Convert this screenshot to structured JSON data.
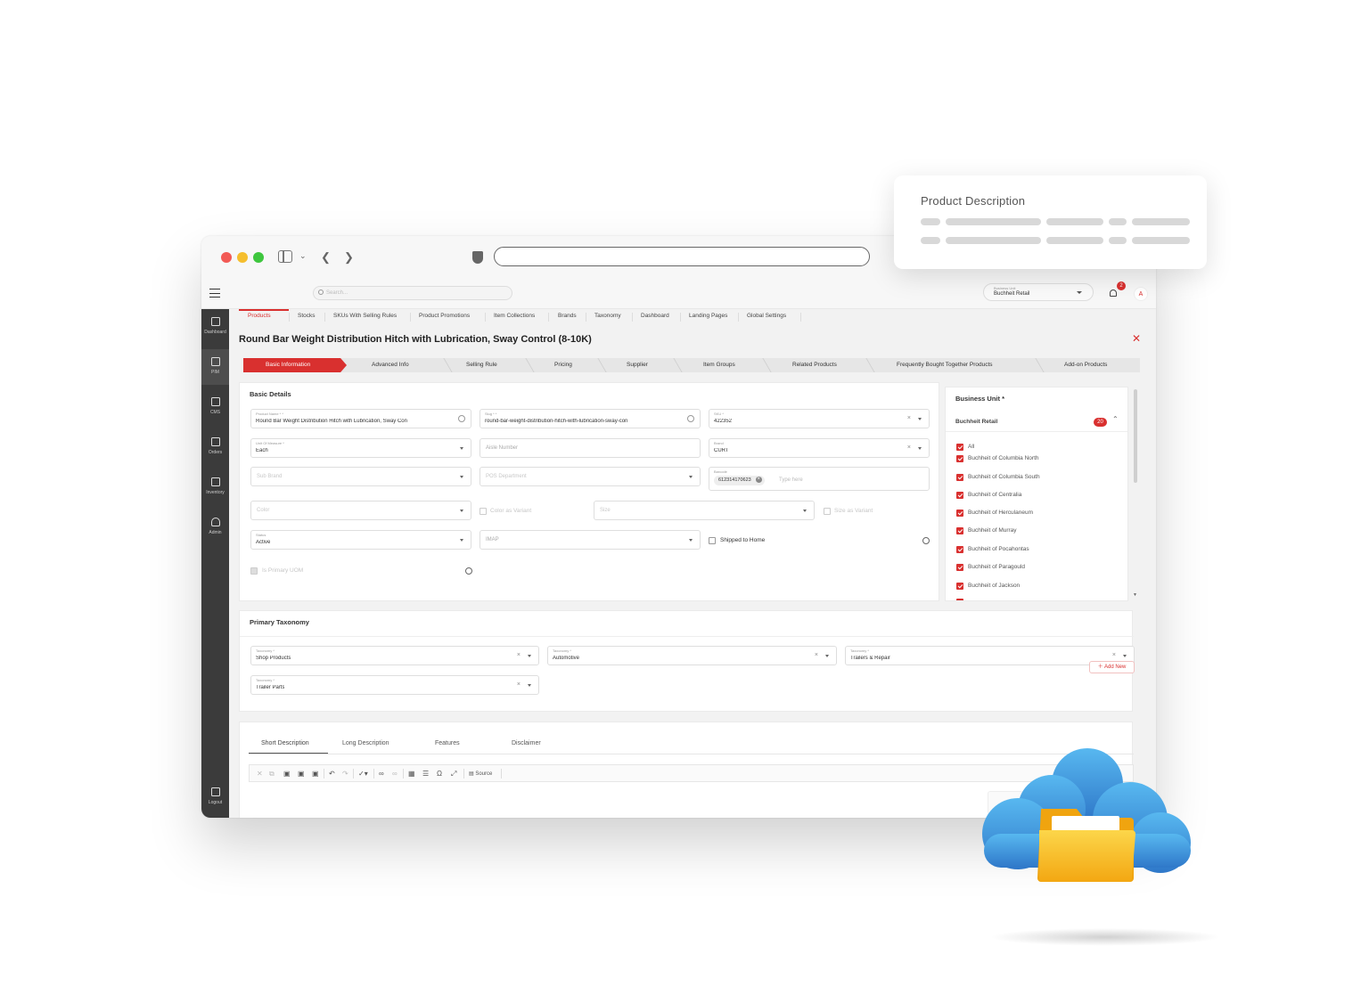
{
  "topbar": {
    "search_placeholder": "Search...",
    "business_unit_label": "Business Unit",
    "business_unit_value": "Buchheit Retail",
    "notification_count": "2",
    "avatar_initial": "A"
  },
  "leftnav": [
    {
      "label": "Dashboard",
      "icon": "dashboard-icon"
    },
    {
      "label": "PIM",
      "icon": "pim-icon"
    },
    {
      "label": "CMS",
      "icon": "cms-icon"
    },
    {
      "label": "Orders",
      "icon": "orders-icon"
    },
    {
      "label": "Inventory",
      "icon": "inventory-icon"
    },
    {
      "label": "Admin",
      "icon": "admin-icon"
    },
    {
      "label": "Logout",
      "icon": "logout-icon"
    }
  ],
  "tabs": [
    "Products",
    "Stocks",
    "SKUs With Selling Rules",
    "Product Promotions",
    "Item Collections",
    "Brands",
    "Taxonomy",
    "Dashboard",
    "Landing Pages",
    "Global Settings"
  ],
  "page_title": "Round Bar Weight Distribution Hitch with Lubrication, Sway Control (8-10K)",
  "steps": [
    "Basic Information",
    "Advanced Info",
    "Selling Rule",
    "Pricing",
    "Supplier",
    "Item Groups",
    "Related Products",
    "Frequently Bought Together Products",
    "Add-on Products"
  ],
  "basic_details": {
    "title": "Basic Details",
    "product_name": {
      "label": "Product Name * *",
      "value": "Round Bar Weight Distribution Hitch with Lubrication, Sway Con"
    },
    "slug": {
      "label": "Slug * *",
      "value": "round-bar-weight-distribution-hitch-with-lubrication-sway-con"
    },
    "sku": {
      "label": "SKU *",
      "value": "422352"
    },
    "uom": {
      "label": "Unit Of Measure *",
      "value": "Each"
    },
    "aisle_number": {
      "placeholder": "Aisle Number"
    },
    "brand": {
      "label": "Brand",
      "value": "CURT"
    },
    "sub_brand": {
      "placeholder": "Sub Brand"
    },
    "pos_department": {
      "placeholder": "POS Department"
    },
    "barcode": {
      "label": "Barcode",
      "chip": "612314170623",
      "placeholder": "Type here"
    },
    "color": {
      "placeholder": "Color"
    },
    "color_as_variant": "Color as Variant",
    "size": {
      "placeholder": "Size"
    },
    "size_as_variant": "Size as Variant",
    "status": {
      "label": "Status",
      "value": "Active"
    },
    "imap": {
      "placeholder": "IMAP"
    },
    "shipped_to_home": "Shipped to Home",
    "is_primary_uom": "Is Primary UOM"
  },
  "business_unit_panel": {
    "title": "Business Unit *",
    "selected": "Buchheit Retail",
    "count": "20",
    "items": [
      "All",
      "Buchheit of Columbia North",
      "Buchheit of Columbia South",
      "Buchheit of Centralia",
      "Buchheit of Herculaneum",
      "Buchheit of Murray",
      "Buchheit of Pocahontas",
      "Buchheit of Paragould",
      "Buchheit of Jackson"
    ]
  },
  "primary_taxonomy": {
    "title": "Primary Taxonomy",
    "add_new": "Add New",
    "field_label": "Taxonomy *",
    "values": [
      "Shop Products",
      "Automotive",
      "Trailers & Repair",
      "Trailer Parts"
    ]
  },
  "description_tabs": [
    "Short Description",
    "Long Description",
    "Features",
    "Disclaimer"
  ],
  "editor": {
    "source_label": "Source"
  },
  "card": {
    "title": "Product Description"
  },
  "colors": {
    "accent": "#d9302f",
    "sidebar": "#3b3b3b",
    "cloud": "#3a8fd8",
    "folder": "#f7c21b"
  }
}
